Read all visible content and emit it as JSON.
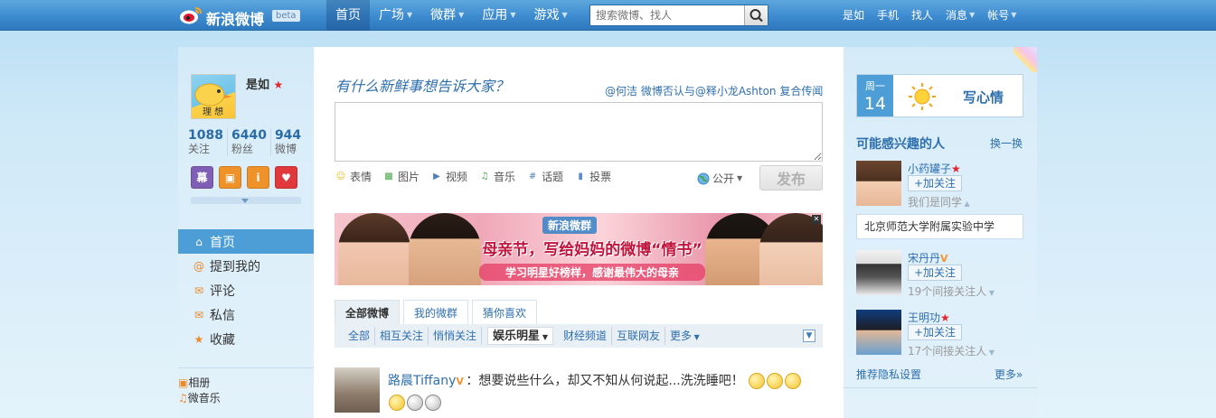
{
  "header": {
    "logo_text": "新浪微博",
    "beta": "beta",
    "nav": [
      {
        "label": "首页",
        "active": true,
        "caret": false
      },
      {
        "label": "广场",
        "active": false,
        "caret": true
      },
      {
        "label": "微群",
        "active": false,
        "caret": true
      },
      {
        "label": "应用",
        "active": false,
        "caret": true
      },
      {
        "label": "游戏",
        "active": false,
        "caret": true
      }
    ],
    "search_placeholder": "搜索微博、找人",
    "right_links": [
      "是如",
      "手机",
      "找人",
      "消息",
      "帐号"
    ]
  },
  "profile": {
    "name": "是如",
    "avatar_text": "理 想",
    "stats": [
      {
        "num": "1088",
        "label": "关注"
      },
      {
        "num": "6440",
        "label": "粉丝"
      },
      {
        "num": "944",
        "label": "微博"
      }
    ],
    "apps": [
      {
        "glyph": "幕",
        "color": "#7f5fb5"
      },
      {
        "glyph": "▣",
        "color": "#f0922a"
      },
      {
        "glyph": "i",
        "color": "#f0922a"
      },
      {
        "glyph": "♥",
        "color": "#e0383b"
      }
    ]
  },
  "left_nav": [
    {
      "label": "首页",
      "icon": "home-icon",
      "glyph": "⌂",
      "active": true
    },
    {
      "label": "提到我的",
      "icon": "at-icon",
      "glyph": "@",
      "active": false
    },
    {
      "label": "评论",
      "icon": "comment-icon",
      "glyph": "✉",
      "active": false
    },
    {
      "label": "私信",
      "icon": "message-icon",
      "glyph": "✉",
      "active": false
    },
    {
      "label": "收藏",
      "icon": "star-icon",
      "glyph": "★",
      "active": false
    }
  ],
  "left_nav2": [
    {
      "label": "相册",
      "icon": "album-icon",
      "glyph": "▣"
    },
    {
      "label": "微音乐",
      "icon": "music-icon",
      "glyph": "♫"
    }
  ],
  "composer": {
    "prompt": "有什么新鲜事想告诉大家？",
    "topic": "@何洁 微博否认与@释小龙Ashton 复合传闻",
    "tools": [
      {
        "label": "表情",
        "icon": "emoticon-icon",
        "glyph": "☺",
        "color": "#f5b80f"
      },
      {
        "label": "图片",
        "icon": "image-icon",
        "glyph": "▩",
        "color": "#4aa84a"
      },
      {
        "label": "视频",
        "icon": "video-icon",
        "glyph": "▶",
        "color": "#4d7fb8"
      },
      {
        "label": "音乐",
        "icon": "music-icon",
        "glyph": "♫",
        "color": "#3ca83c"
      },
      {
        "label": "话题",
        "icon": "topic-icon",
        "glyph": "#",
        "color": "#4d7fb8"
      },
      {
        "label": "投票",
        "icon": "vote-icon",
        "glyph": "▮",
        "color": "#5b8ec8"
      }
    ],
    "visibility": "公开",
    "publish": "发布"
  },
  "banner": {
    "logo": "新浪微群",
    "headline": "母亲节，写给妈妈的微博“情书”",
    "sub": "学习明星好榜样，感谢最伟大的母亲"
  },
  "tabs": [
    {
      "label": "全部微博",
      "active": true
    },
    {
      "label": "我的微群",
      "active": false
    },
    {
      "label": "猜你喜欢",
      "active": false
    }
  ],
  "filters": [
    {
      "label": "全部",
      "active": false
    },
    {
      "label": "相互关注",
      "active": false
    },
    {
      "label": "悄悄关注",
      "active": false
    },
    {
      "label": "娱乐明星",
      "active": true
    },
    {
      "label": "财经频道",
      "active": false
    },
    {
      "label": "互联网友",
      "active": false
    },
    {
      "label": "更多",
      "active": false
    }
  ],
  "feed": {
    "author": "路晨Tiffany",
    "text": "：想要说些什么，却又不知从何说起...洗洗睡吧！"
  },
  "date_card": {
    "weekday": "周一",
    "day": "14",
    "write": "写心情"
  },
  "suggest": {
    "title": "可能感兴趣的人",
    "refresh": "换一换",
    "follow_label": "+加关注",
    "people": [
      {
        "name": "小药罐子",
        "note": "我们是同学",
        "badge": "star"
      },
      {
        "name": "宋丹丹",
        "note": "19个间接关注人",
        "badge": "v"
      },
      {
        "name": "王明功",
        "note": "17个间接关注人",
        "badge": "star"
      }
    ],
    "school": "北京师范大学附属实验中学",
    "privacy": "推荐隐私设置",
    "more": "更多»"
  }
}
